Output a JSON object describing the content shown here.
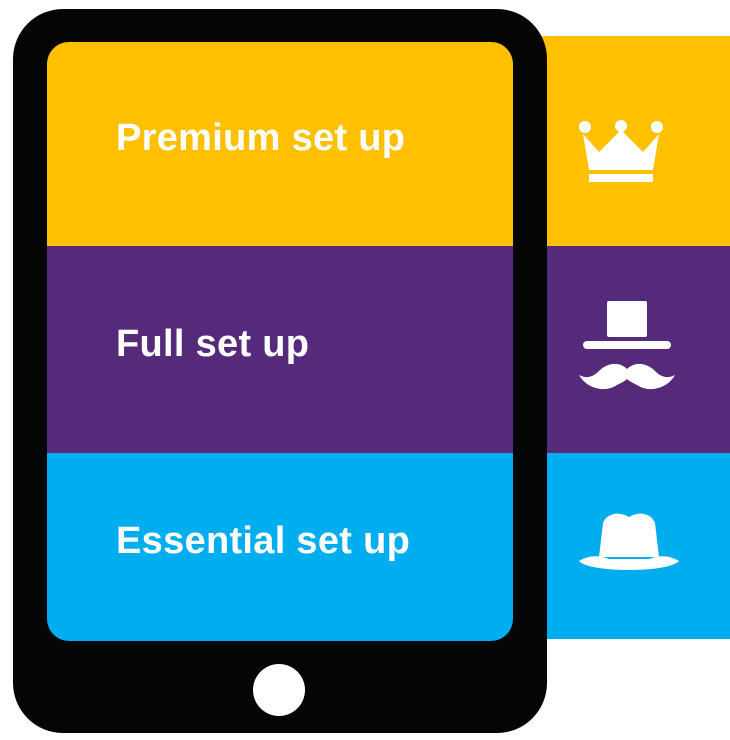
{
  "tiers": [
    {
      "label": "Premium set up",
      "icon": "crown-icon",
      "color": "#FEC000"
    },
    {
      "label": "Full set up",
      "icon": "top-hat-mustache-icon",
      "color": "#552A7A"
    },
    {
      "label": "Essential set up",
      "icon": "hat-icon",
      "color": "#00AEEF"
    }
  ]
}
